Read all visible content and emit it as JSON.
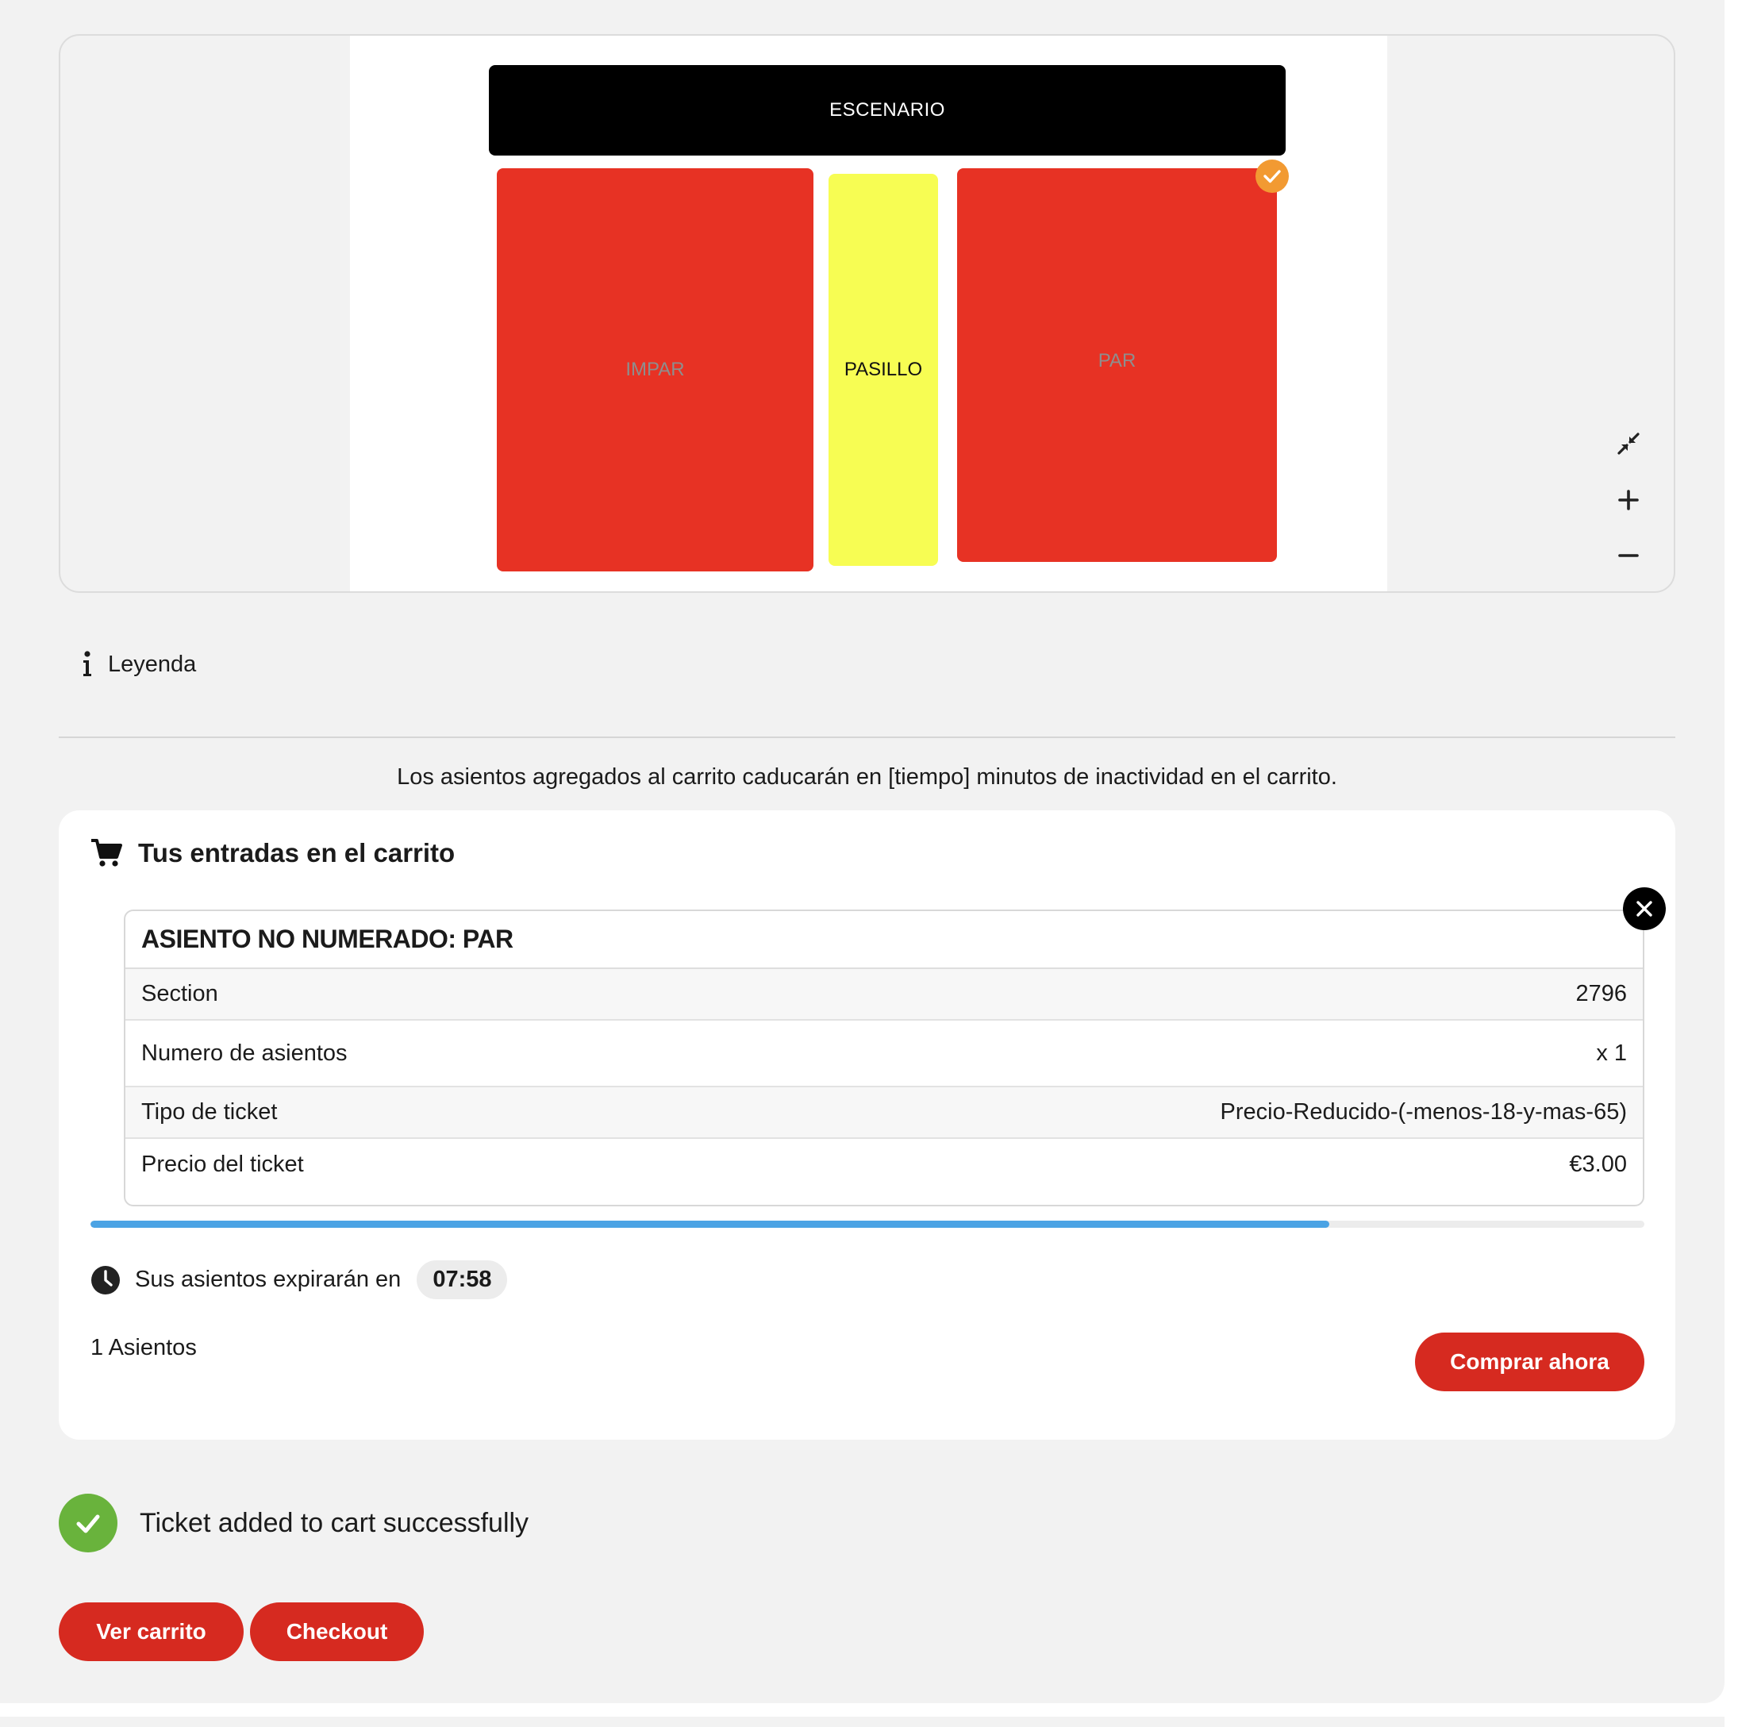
{
  "seat_map": {
    "stage_label": "ESCENARIO",
    "sections": [
      {
        "label": "IMPAR",
        "color": "#e73224"
      },
      {
        "label": "PASILLO",
        "color": "#f7fd53"
      },
      {
        "label": "PAR",
        "color": "#e73224",
        "selected": true
      }
    ],
    "controls": [
      "collapse-icon",
      "zoom-in-icon",
      "zoom-out-icon"
    ]
  },
  "legend": {
    "label": "Leyenda"
  },
  "notice": "Los asientos agregados al carrito caducarán en [tiempo] minutos de inactividad en el carrito.",
  "cart": {
    "title": "Tus entradas en el carrito",
    "ticket": {
      "heading": "ASIENTO NO NUMERADO: PAR",
      "rows": [
        {
          "label": "Section",
          "value": "2796"
        },
        {
          "label": "Numero de asientos",
          "value": "x 1"
        },
        {
          "label": "Tipo de ticket",
          "value": "Precio-Reducido-(-menos-18-y-mas-65)"
        },
        {
          "label": "Precio del ticket",
          "value": "€3.00"
        }
      ]
    },
    "progress_fraction": 0.797,
    "expiry_label": "Sus asientos expirarán en",
    "expiry_time": "07:58",
    "seat_count": "1 Asientos",
    "buy_label": "Comprar ahora"
  },
  "toast": {
    "message": "Ticket added to cart successfully"
  },
  "actions": {
    "view_cart": "Ver carrito",
    "checkout": "Checkout"
  },
  "colors": {
    "accent": "#d62a20",
    "progress": "#4ba3e4",
    "success": "#69b33c",
    "selected": "#f29a32"
  }
}
